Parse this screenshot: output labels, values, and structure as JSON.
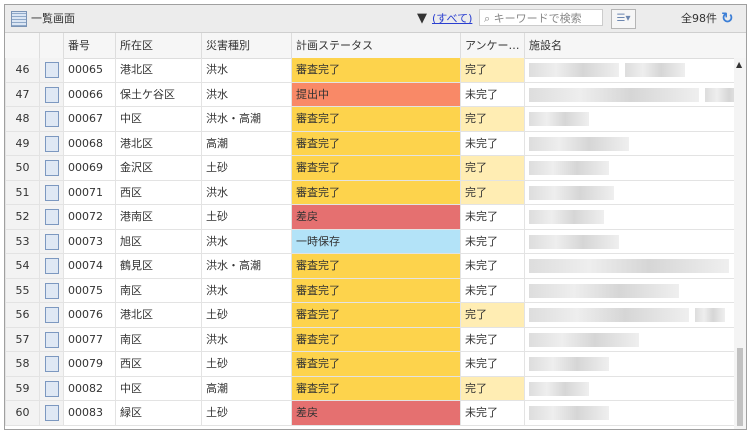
{
  "toolbar": {
    "title": "一覧画面",
    "filter_label": "(すべて)",
    "search_placeholder": "キーワードで検索",
    "count": "全98件"
  },
  "columns": [
    "番号",
    "所在区",
    "災害種別",
    "計画ステータス",
    "アンケー…",
    "施設名"
  ],
  "status_colors": {
    "審査完了": "#fdd34c",
    "提出中": "#f98967",
    "差戻": "#e57070",
    "一時保存": "#b3e3f8"
  },
  "survey_colors": {
    "完了": "#ffedb3",
    "未完了": "#ffffff"
  },
  "rows": [
    [
      "46",
      "00065",
      "港北区",
      "洪水",
      "審査完了",
      "完了"
    ],
    [
      "47",
      "00066",
      "保土ケ谷区",
      "洪水",
      "提出中",
      "未完了"
    ],
    [
      "48",
      "00067",
      "中区",
      "洪水・高潮",
      "審査完了",
      "完了"
    ],
    [
      "49",
      "00068",
      "港北区",
      "高潮",
      "審査完了",
      "未完了"
    ],
    [
      "50",
      "00069",
      "金沢区",
      "土砂",
      "審査完了",
      "完了"
    ],
    [
      "51",
      "00071",
      "西区",
      "洪水",
      "審査完了",
      "完了"
    ],
    [
      "52",
      "00072",
      "港南区",
      "土砂",
      "差戻",
      "未完了"
    ],
    [
      "53",
      "00073",
      "旭区",
      "洪水",
      "一時保存",
      "未完了"
    ],
    [
      "54",
      "00074",
      "鶴見区",
      "洪水・高潮",
      "審査完了",
      "未完了"
    ],
    [
      "55",
      "00075",
      "南区",
      "洪水",
      "審査完了",
      "未完了"
    ],
    [
      "56",
      "00076",
      "港北区",
      "土砂",
      "審査完了",
      "完了"
    ],
    [
      "57",
      "00077",
      "南区",
      "洪水",
      "審査完了",
      "未完了"
    ],
    [
      "58",
      "00079",
      "西区",
      "土砂",
      "審査完了",
      "未完了"
    ],
    [
      "59",
      "00082",
      "中区",
      "高潮",
      "審査完了",
      "完了"
    ],
    [
      "60",
      "00083",
      "緑区",
      "土砂",
      "差戻",
      "未完了"
    ]
  ]
}
